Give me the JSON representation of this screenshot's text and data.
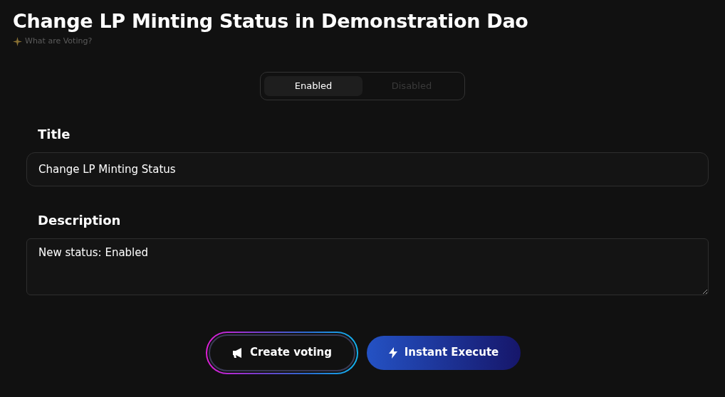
{
  "title": "Change LP Minting Status in Demonstration Dao",
  "help_link": "What are Voting?",
  "status_tabs": [
    {
      "label": "Enabled",
      "selected": true
    },
    {
      "label": "Disabled",
      "selected": false
    }
  ],
  "fields": [
    {
      "kind": "input",
      "label": "Title",
      "value": "Change LP Minting Status"
    },
    {
      "kind": "textarea",
      "label": "Description",
      "value": "New status: Enabled"
    }
  ],
  "buttons": [
    {
      "kind": "outline",
      "label": "Create voting"
    },
    {
      "kind": "primary",
      "label": "Instant Execute"
    }
  ]
}
